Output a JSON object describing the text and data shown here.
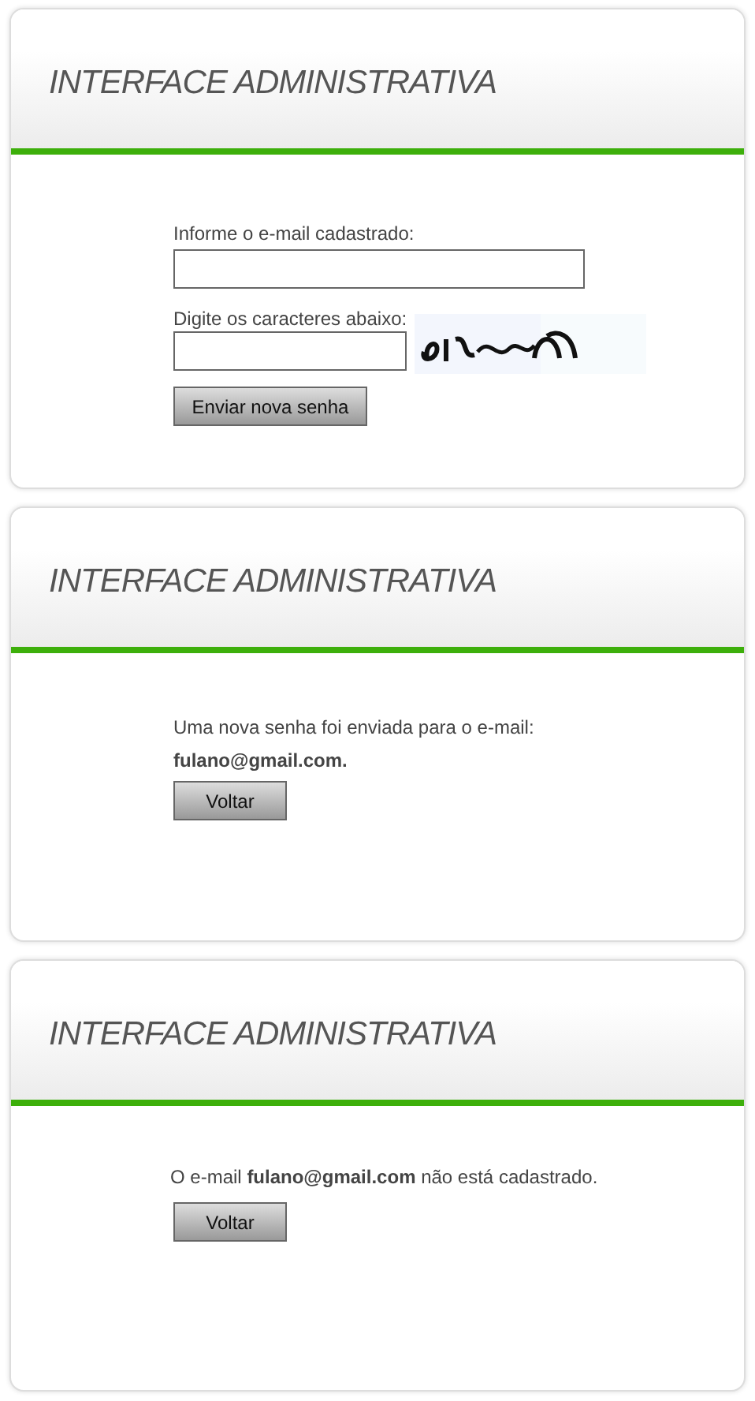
{
  "panels": [
    {
      "kind": "form",
      "title": "INTERFACE ADMINISTRATIVA",
      "email_label": "Informe o e-mail cadastrado:",
      "captcha_label": "Digite os caracteres abaixo:",
      "button": "Enviar nova senha"
    },
    {
      "kind": "sent",
      "title": "INTERFACE ADMINISTRATIVA",
      "message": "Uma nova senha foi enviada para o e-mail:",
      "email": "fulano@gmail.com.",
      "button": "Voltar"
    },
    {
      "kind": "not_registered",
      "title": "INTERFACE ADMINISTRATIVA",
      "message": "O e-mail **fulano@gmail.com** não está cadastrado.",
      "button": "Voltar"
    }
  ]
}
